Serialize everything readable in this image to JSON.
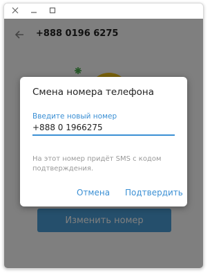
{
  "window": {
    "controls": [
      "close-icon",
      "minimize-icon",
      "maximize-icon"
    ]
  },
  "header": {
    "title": "+888 0196 6275",
    "back_icon": "arrow-left-icon"
  },
  "content": {
    "action_button_label": "Изменить номер"
  },
  "dialog": {
    "title": "Смена номера телефона",
    "field_label": "Введите новый номер",
    "field_value": "+888 0 1966275",
    "hint": "На этот номер придёт SMS с кодом подтверждения.",
    "cancel_label": "Отмена",
    "confirm_label": "Подтвердить"
  },
  "colors": {
    "accent": "#3a8fd4",
    "button": "#4a9fd9",
    "overlay": "rgba(0,0,0,0.5)",
    "illustration_yellow": "#f5c518",
    "illustration_green": "#4caf50"
  }
}
